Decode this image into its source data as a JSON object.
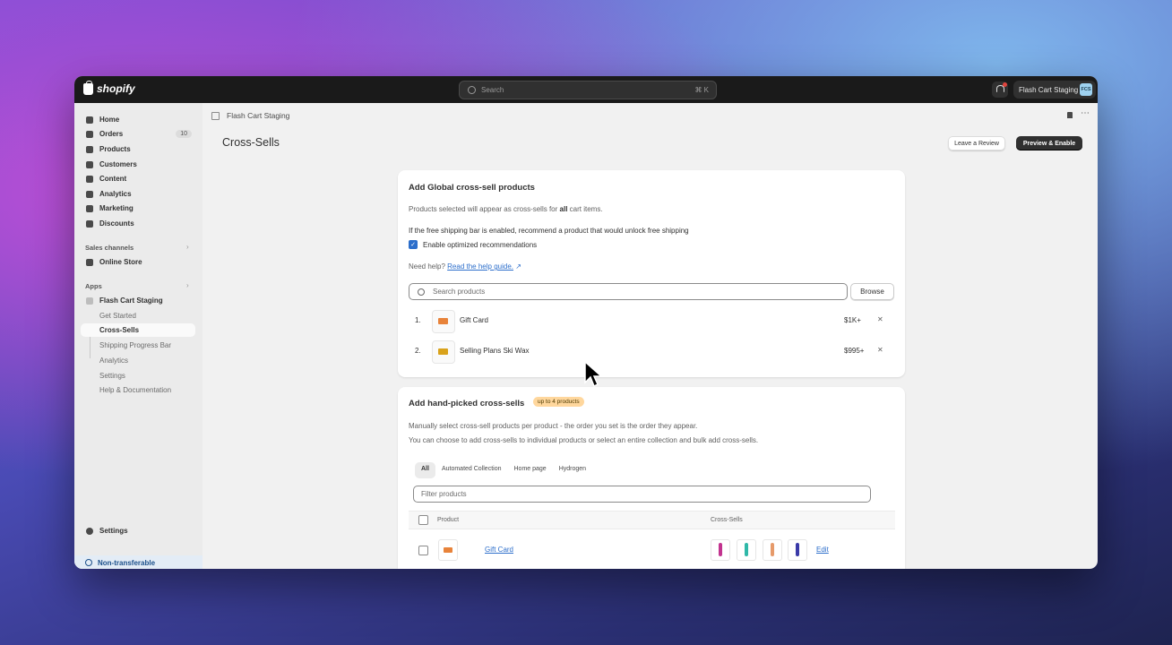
{
  "topbar": {
    "brand": "shopify",
    "search_placeholder": "Search",
    "search_shortcut": "⌘ K",
    "store_name": "Flash Cart Staging",
    "store_initials": "FCS"
  },
  "sidebar": {
    "items": [
      {
        "label": "Home",
        "icon": "home-icon"
      },
      {
        "label": "Orders",
        "icon": "orders-icon",
        "badge": "10"
      },
      {
        "label": "Products",
        "icon": "tag-icon"
      },
      {
        "label": "Customers",
        "icon": "person-icon"
      },
      {
        "label": "Content",
        "icon": "content-icon"
      },
      {
        "label": "Analytics",
        "icon": "chart-icon"
      },
      {
        "label": "Marketing",
        "icon": "target-icon"
      },
      {
        "label": "Discounts",
        "icon": "discount-icon"
      }
    ],
    "sales_channels_label": "Sales channels",
    "online_store": "Online Store",
    "apps_label": "Apps",
    "app_name": "Flash Cart Staging",
    "app_subitems": [
      "Get Started",
      "Cross-Sells",
      "Shipping Progress Bar",
      "Analytics",
      "Settings",
      "Help & Documentation"
    ],
    "settings": "Settings",
    "non_transferable": "Non-transferable"
  },
  "header": {
    "breadcrumb": "Flash Cart Staging",
    "title": "Cross-Sells",
    "leave_review": "Leave a Review",
    "preview_enable": "Preview & Enable"
  },
  "global_card": {
    "title": "Add Global cross-sell products",
    "desc_prefix": "Products selected will appear as cross-sells for ",
    "desc_bold": "all",
    "desc_suffix": " cart items.",
    "shipping_note": "If the free shipping bar is enabled, recommend a product that would unlock free shipping",
    "checkbox_label": "Enable optimized recommendations",
    "checkbox_checked": true,
    "help_prefix": "Need help? ",
    "help_link": "Read the help guide.",
    "search_placeholder": "Search products",
    "browse": "Browse",
    "products": [
      {
        "num": "1.",
        "name": "Gift Card",
        "price": "$1K+",
        "thumb_color": "#e8833a"
      },
      {
        "num": "2.",
        "name": "Selling Plans Ski Wax",
        "price": "$995+",
        "thumb_color": "#d9a21b"
      }
    ]
  },
  "handpicked_card": {
    "title": "Add hand-picked cross-sells",
    "pill": "up to 4 products",
    "desc1": "Manually select cross-sell products per product - the order you set is the order they appear.",
    "desc2": "You can choose to add cross-sells to individual products or select an entire collection and bulk add cross-sells.",
    "tabs": [
      "All",
      "Automated Collection",
      "Home page",
      "Hydrogen"
    ],
    "filter_placeholder": "Filter products",
    "col_product": "Product",
    "col_crosssells": "Cross-Sells",
    "row": {
      "name": "Gift Card",
      "edit": "Edit",
      "thumb_color": "#e8833a"
    },
    "cross_sell_colors": [
      "#c2338f",
      "#2fb8a8",
      "#e69a6a",
      "#3a3aa8"
    ]
  }
}
